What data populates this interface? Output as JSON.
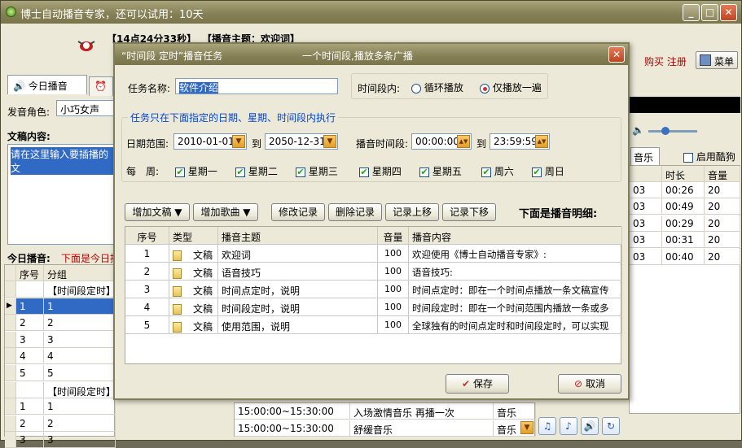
{
  "window": {
    "title": "博士自动播音专家，还可以试用：10天",
    "min": "_",
    "max": "□",
    "close": "✕"
  },
  "header": {
    "time": "【14点24分33秒】",
    "topic": "【播音主题：欢迎词】",
    "buy": "购买",
    "register": "注册",
    "menu": "菜单"
  },
  "left": {
    "tab_today": "今日播音",
    "role_label": "发音角色:",
    "role_value": "小巧女声",
    "content_label": "文稿内容:",
    "content_value": "请在这里输入要插播的文",
    "today_label": "今日播音:",
    "today_hint": "下面是今日播",
    "cols": [
      "序号",
      "分组"
    ],
    "rows": [
      {
        "no": "",
        "group": "【时间段定时】"
      },
      {
        "no": "1",
        "group": "1"
      },
      {
        "no": "2",
        "group": "2"
      },
      {
        "no": "3",
        "group": "3"
      },
      {
        "no": "4",
        "group": "4"
      },
      {
        "no": "5",
        "group": "5"
      },
      {
        "no": "",
        "group": "【时间段定时】"
      },
      {
        "no": "1",
        "group": "1"
      },
      {
        "no": "2",
        "group": "2"
      },
      {
        "no": "3",
        "group": "3"
      }
    ],
    "bottom_rows": [
      {
        "time": "15:00:00~15:30:00",
        "content": "入场激情音乐 再播一次",
        "type": "音乐"
      },
      {
        "time": "15:00:00~15:30:00",
        "content": "舒缓音乐",
        "type": "音乐"
      }
    ]
  },
  "right": {
    "tab_music": "音乐",
    "cool_label": "启用酷狗",
    "cols": [
      "时长",
      "音量"
    ],
    "rows": [
      {
        "p": "03",
        "d": "00:26",
        "v": "20"
      },
      {
        "p": "03",
        "d": "00:49",
        "v": "20"
      },
      {
        "p": "03",
        "d": "00:29",
        "v": "20"
      },
      {
        "p": "03",
        "d": "00:31",
        "v": "20"
      },
      {
        "p": "03",
        "d": "00:40",
        "v": "20"
      }
    ]
  },
  "dialog": {
    "title_left": "“时间段 定时”播音任务",
    "title_right": "一个时间段,播放多条广播",
    "task_label": "任务名称:",
    "task_value": "软件介绍",
    "period_label": "时间段内:",
    "loop": "循环播放",
    "once": "仅播放一遍",
    "group_title": "任务只在下面指定的日期、星期、时间段内执行",
    "date_label": "日期范围:",
    "date_from": "2010-01-01",
    "to": "到",
    "date_to": "2050-12-31",
    "time_label": "播音时间段:",
    "time_from": "00:00:00",
    "time_to": "23:59:59",
    "week_label": "每　周:",
    "days": [
      "星期一",
      "星期二",
      "星期三",
      "星期四",
      "星期五",
      "周六",
      "周日"
    ],
    "btns": {
      "add_doc": "增加文稿",
      "add_song": "增加歌曲",
      "edit": "修改记录",
      "delete": "删除记录",
      "up": "记录上移",
      "down": "记录下移"
    },
    "detail_label": "下面是播音明细:",
    "cols": [
      "序号",
      "类型",
      "播音主题",
      "音量",
      "播音内容"
    ],
    "rows": [
      {
        "no": "1",
        "type": "文稿",
        "topic": "欢迎词",
        "vol": "100",
        "content": "欢迎使用《博士自动播音专家》:"
      },
      {
        "no": "2",
        "type": "文稿",
        "topic": "语音技巧",
        "vol": "100",
        "content": "语音技巧:"
      },
      {
        "no": "3",
        "type": "文稿",
        "topic": "时间点定时，说明",
        "vol": "100",
        "content": "时间点定时：即在一个时间点播放一条文稿宣传"
      },
      {
        "no": "4",
        "type": "文稿",
        "topic": "时间段定时，说明",
        "vol": "100",
        "content": "时间段定时：即在一个时间范围内播放一条或多"
      },
      {
        "no": "5",
        "type": "文稿",
        "topic": "使用范围，说明",
        "vol": "100",
        "content": "全球独有的时间点定时和时间段定时，可以实现"
      }
    ],
    "save": "保存",
    "cancel": "取消"
  }
}
